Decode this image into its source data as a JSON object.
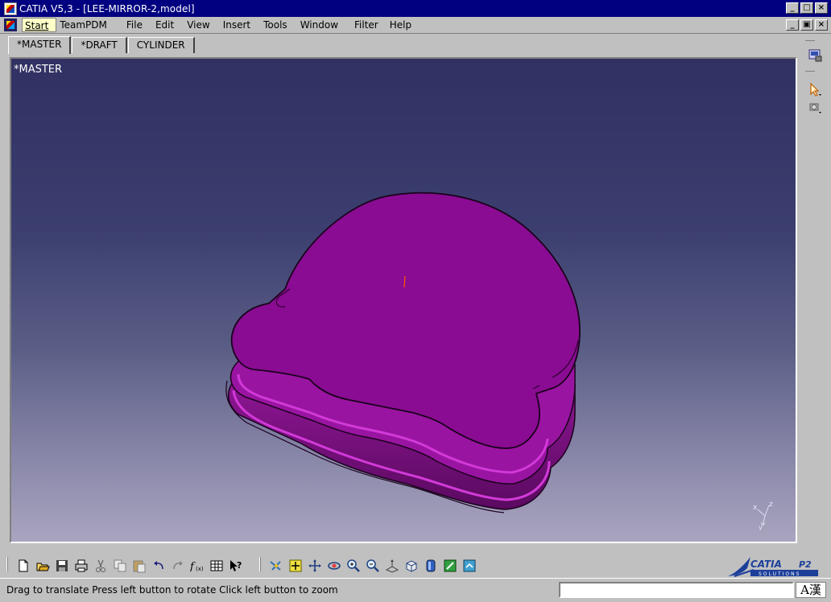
{
  "window": {
    "title": "CATIA V5,3 - [LEE-MIRROR-2,model]",
    "controls": [
      "_",
      "□",
      "×"
    ]
  },
  "menubar": {
    "items": [
      {
        "label": "Start",
        "active": true
      },
      {
        "label": "TeamPDM"
      },
      {
        "label": "File"
      },
      {
        "label": "Edit"
      },
      {
        "label": "View"
      },
      {
        "label": "Insert"
      },
      {
        "label": "Tools"
      },
      {
        "label": "Window"
      },
      {
        "label": "Filter"
      },
      {
        "label": "Help"
      }
    ],
    "mdi_controls": [
      "_",
      "▣",
      "×"
    ]
  },
  "tabs": [
    {
      "label": "*MASTER",
      "active": true
    },
    {
      "label": "*DRAFT"
    },
    {
      "label": "CYLINDER"
    }
  ],
  "viewport": {
    "label": "*MASTER",
    "part_color": "#8a0c92",
    "compass_axes": [
      "x",
      "z",
      "y"
    ]
  },
  "toolbar": {
    "icons": [
      "new-icon",
      "open-icon",
      "save-icon",
      "print-icon",
      "cut-icon",
      "copy-icon",
      "paste-icon",
      "undo-icon",
      "redo-icon",
      "formula-icon",
      "table-icon",
      "whats-this-icon",
      "fly-mode-icon",
      "fit-all-icon",
      "pan-icon",
      "rotate-icon",
      "zoom-in-icon",
      "zoom-out-icon",
      "normal-view-icon",
      "view-cube-icon",
      "render-style-icon",
      "hide-show-icon",
      "swap-visible-icon"
    ]
  },
  "brand": {
    "name": "CATIA",
    "suffix": "P2",
    "subtitle": "SOLUTIONS"
  },
  "status": {
    "message": "Drag to translate  Press left button to rotate  Click left button to zoom",
    "input_value": "",
    "ime_label": "A漢"
  }
}
